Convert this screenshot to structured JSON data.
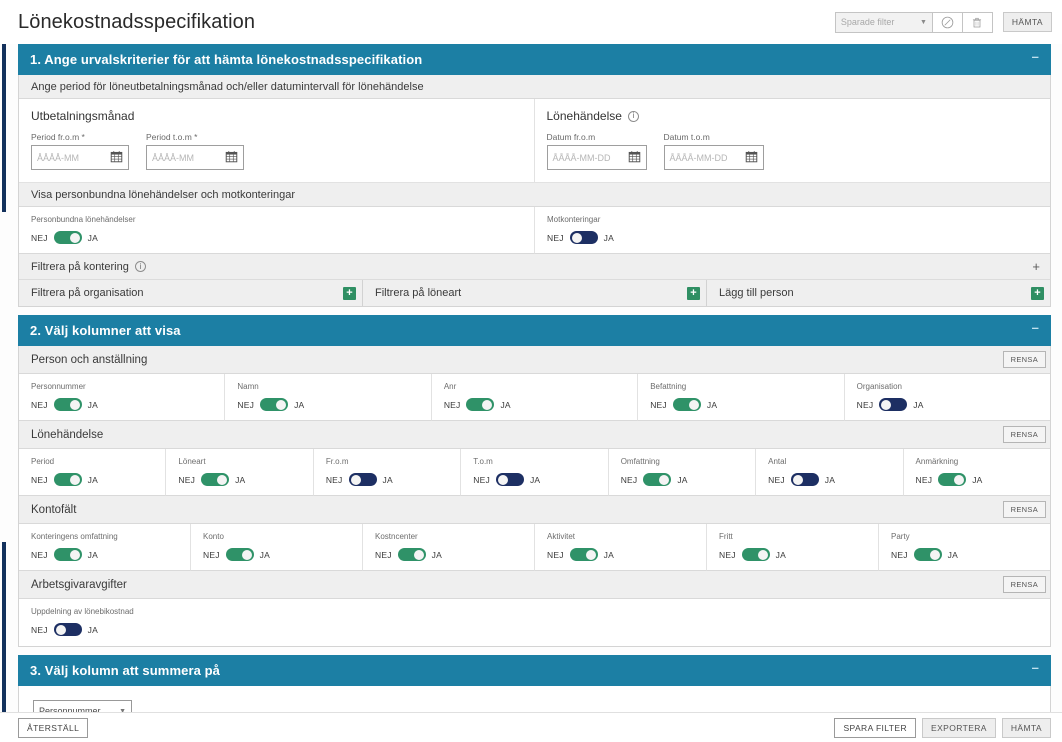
{
  "header": {
    "title": "Lönekostnadsspecifikation",
    "saved_filter_placeholder": "Sparade filter",
    "edit_icon": "edit-pencil-icon",
    "delete_icon": "trash-icon",
    "fetch_label": "HÄMTA"
  },
  "section1": {
    "title": "1. Ange urvalskriterier för att hämta lönekostnadsspecifikation",
    "collapse_icon": "minus-icon",
    "subheader": "Ange period för löneutbetalningsmånad och/eller datumintervall för lönehändelse",
    "payout": {
      "title": "Utbetalningsmånad",
      "from_label": "Period fr.o.m *",
      "from_placeholder": "ÅÅÅÅ-MM",
      "to_label": "Period t.o.m *",
      "to_placeholder": "ÅÅÅÅ-MM"
    },
    "event": {
      "title": "Lönehändelse",
      "info_icon": "info-icon",
      "from_label": "Datum fr.o.m",
      "from_placeholder": "ÅÅÅÅ-MM-DD",
      "to_label": "Datum t.o.m",
      "to_placeholder": "ÅÅÅÅ-MM-DD"
    },
    "show_subheader": "Visa personbundna lönehändelser och motkonteringar",
    "toggles": [
      {
        "label": "Personbundna lönehändelser",
        "off_label": "NEJ",
        "on_label": "JA",
        "value": true
      },
      {
        "label": "Motkonteringar",
        "off_label": "NEJ",
        "on_label": "JA",
        "value": false
      }
    ],
    "filter_kontering": "Filtrera på kontering",
    "filter_kontering_plus": "+",
    "filters": [
      {
        "label": "Filtrera på organisation",
        "add_icon": "plus-icon"
      },
      {
        "label": "Filtrera på löneart",
        "add_icon": "plus-icon"
      },
      {
        "label": "Lägg till person",
        "add_icon": "plus-icon"
      }
    ]
  },
  "section2": {
    "title": "2. Välj kolumner att visa",
    "collapse_icon": "minus-icon",
    "clear_label": "RENSA",
    "groups": [
      {
        "title": "Person och anställning",
        "columns": [
          {
            "label": "Personnummer",
            "off_label": "NEJ",
            "on_label": "JA",
            "value": true
          },
          {
            "label": "Namn",
            "off_label": "NEJ",
            "on_label": "JA",
            "value": true
          },
          {
            "label": "Anr",
            "off_label": "NEJ",
            "on_label": "JA",
            "value": true
          },
          {
            "label": "Befattning",
            "off_label": "NEJ",
            "on_label": "JA",
            "value": true
          },
          {
            "label": "Organisation",
            "off_label": "NEJ",
            "on_label": "JA",
            "value": false
          }
        ]
      },
      {
        "title": "Lönehändelse",
        "columns": [
          {
            "label": "Period",
            "off_label": "NEJ",
            "on_label": "JA",
            "value": true
          },
          {
            "label": "Löneart",
            "off_label": "NEJ",
            "on_label": "JA",
            "value": true
          },
          {
            "label": "Fr.o.m",
            "off_label": "NEJ",
            "on_label": "JA",
            "value": false
          },
          {
            "label": "T.o.m",
            "off_label": "NEJ",
            "on_label": "JA",
            "value": false
          },
          {
            "label": "Omfattning",
            "off_label": "NEJ",
            "on_label": "JA",
            "value": true
          },
          {
            "label": "Antal",
            "off_label": "NEJ",
            "on_label": "JA",
            "value": false
          },
          {
            "label": "Anmärkning",
            "off_label": "NEJ",
            "on_label": "JA",
            "value": true
          }
        ]
      },
      {
        "title": "Kontofält",
        "columns": [
          {
            "label": "Konteringens omfattning",
            "off_label": "NEJ",
            "on_label": "JA",
            "value": true
          },
          {
            "label": "Konto",
            "off_label": "NEJ",
            "on_label": "JA",
            "value": true
          },
          {
            "label": "Kostncenter",
            "off_label": "NEJ",
            "on_label": "JA",
            "value": true
          },
          {
            "label": "Aktivitet",
            "off_label": "NEJ",
            "on_label": "JA",
            "value": true
          },
          {
            "label": "Fritt",
            "off_label": "NEJ",
            "on_label": "JA",
            "value": true
          },
          {
            "label": "Party",
            "off_label": "NEJ",
            "on_label": "JA",
            "value": true
          }
        ]
      },
      {
        "title": "Arbetsgivaravgifter",
        "columns": [
          {
            "label": "Uppdelning av lönebikostnad",
            "off_label": "NEJ",
            "on_label": "JA",
            "value": false
          }
        ]
      }
    ]
  },
  "section3": {
    "title": "3. Välj kolumn att summera på",
    "collapse_icon": "minus-icon",
    "selected": "Personnummer",
    "caret_icon": "chevron-down-icon"
  },
  "footer": {
    "reset_label": "ÅTERSTÄLL",
    "save_filter_label": "SPARA FILTER",
    "export_label": "EXPORTERA",
    "fetch_label": "HÄMTA"
  },
  "colors": {
    "section_header": "#1c7fa4",
    "toggle_on": "#2f9268",
    "toggle_off": "#1d2f63",
    "accent_rail": "#13315c",
    "plus_green": "#2f8f63"
  }
}
